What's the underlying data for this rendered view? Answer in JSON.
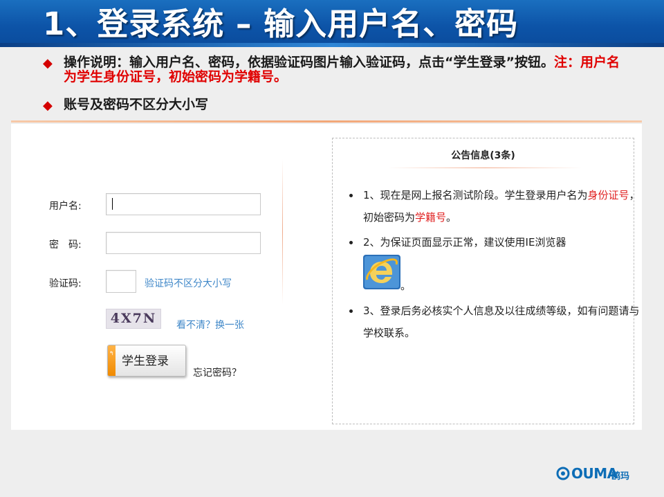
{
  "slide": {
    "title": "1、登录系统 – 输入用户名、密码",
    "notes": [
      {
        "text": "操作说明：输入用户名、密码，依据验证码图片输入验证码，点击“学生登录”按钮。",
        "red": "注：用户名为学生身份证号，初始密码为学籍号。"
      },
      {
        "text": "账号及密码不区分大小写",
        "red": ""
      }
    ]
  },
  "login_form": {
    "username_label": "用户名:",
    "username_value": "",
    "password_label": "密　码:",
    "password_value": "",
    "captcha_label": "验证码:",
    "captcha_value": "",
    "captcha_hint": "验证码不区分大小写",
    "captcha_image_text": "4X7N",
    "refresh_captcha": "看不清？换一张",
    "login_button": "学生登录",
    "forgot_password": "忘记密码？"
  },
  "notice": {
    "title": "公告信息(3条)",
    "items": [
      {
        "text": "1、现在是网上报名测试阶段。学生登录用户名为",
        "red1": "身份证号",
        "mid": "，初始密码为",
        "red2": "学籍号",
        "end": "。"
      },
      {
        "text": "2、为保证页面显示正常，建议使用IE浏览器",
        "end": "。"
      },
      {
        "text": "3、登录后务必核实个人信息及以往成绩等级，如有问题请与学校联系。"
      }
    ]
  },
  "brand": {
    "name": "OUMA",
    "cn": "鸥玛"
  },
  "colors": {
    "title_blue": "#0d54a8",
    "accent_red": "#e00000",
    "link_blue": "#3f87c8",
    "button_orange": "#f08a00",
    "brand_blue": "#0d6db6"
  }
}
